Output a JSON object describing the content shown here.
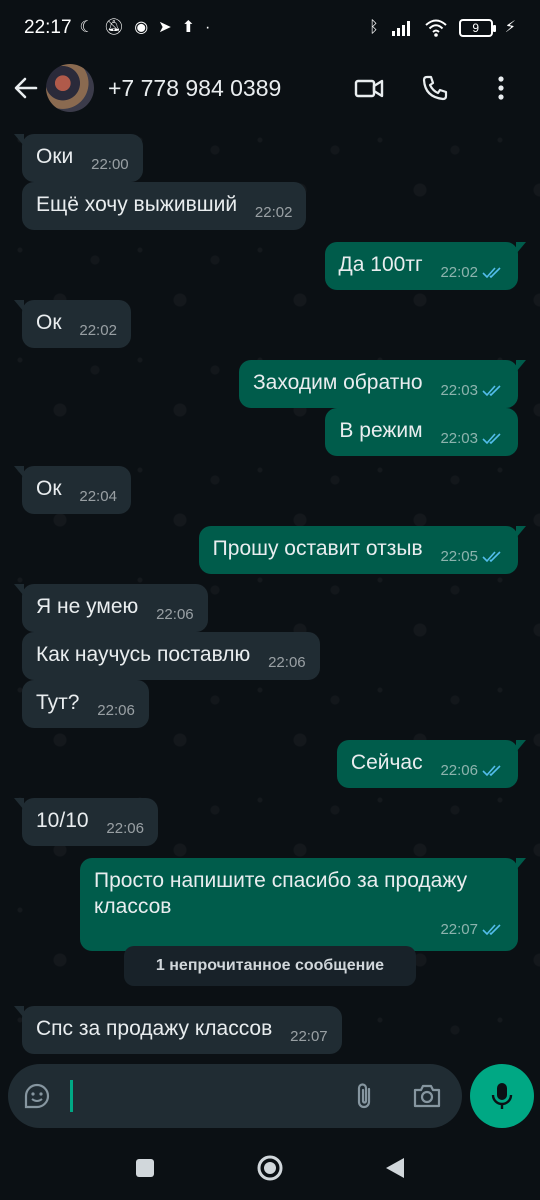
{
  "status_bar": {
    "time": "22:17",
    "battery": "9"
  },
  "header": {
    "contact_name": "+7 778 984 0389"
  },
  "messages": [
    {
      "dir": "in",
      "text": "Оки",
      "time": "22:00"
    },
    {
      "dir": "in",
      "text": "Ещё хочу выживший",
      "time": "22:02"
    },
    {
      "dir": "out",
      "text": "Да 100тг",
      "time": "22:02"
    },
    {
      "dir": "in",
      "text": "Ок",
      "time": "22:02"
    },
    {
      "dir": "out",
      "text": "Заходим обратно",
      "time": "22:03"
    },
    {
      "dir": "out",
      "text": "В режим",
      "time": "22:03"
    },
    {
      "dir": "in",
      "text": "Ок",
      "time": "22:04"
    },
    {
      "dir": "out",
      "text": "Прошу оставит отзыв",
      "time": "22:05"
    },
    {
      "dir": "in",
      "text": "Я не умею",
      "time": "22:06"
    },
    {
      "dir": "in",
      "text": "Как научусь поставлю",
      "time": "22:06"
    },
    {
      "dir": "in",
      "text": "Тут?",
      "time": "22:06"
    },
    {
      "dir": "out",
      "text": "Сейчас",
      "time": "22:06"
    },
    {
      "dir": "in",
      "text": "10/10",
      "time": "22:06"
    },
    {
      "dir": "out",
      "text": "Просто напишите спасибо за продажу классов",
      "time": "22:07"
    },
    {
      "dir": "in",
      "text": "Спс за продажу классов",
      "time": "22:07"
    }
  ],
  "unread_divider": "1 непрочитанное сообщение",
  "colors": {
    "accent": "#00a884",
    "outgoing_bubble": "#005c4b",
    "incoming_bubble": "#202c33",
    "read_ticks": "#53bdeb"
  }
}
